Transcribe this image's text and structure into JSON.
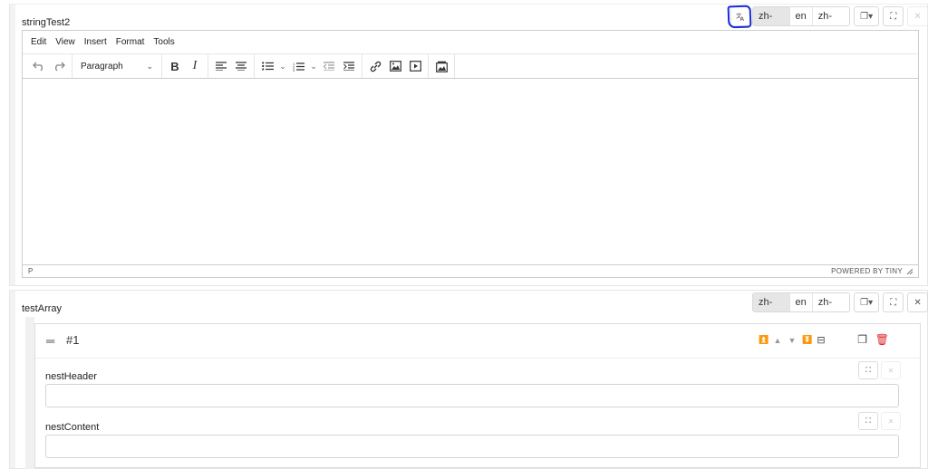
{
  "field1": {
    "label": "stringTest2",
    "translate_icon": "translate-icon",
    "languages": [
      "zh-HK",
      "en",
      "zh-CN"
    ],
    "active_language": "zh-HK",
    "copy_icon": "copy-dropdown-icon",
    "expand_icon": "expand-icon",
    "close_icon": "close-icon"
  },
  "editor": {
    "menus": [
      "Edit",
      "View",
      "Insert",
      "Format",
      "Tools"
    ],
    "block_format": "Paragraph",
    "status_path": "P",
    "powered_by": "POWERED BY TINY"
  },
  "field2": {
    "label": "testArray",
    "languages": [
      "zh-HK",
      "en",
      "zh-CN"
    ],
    "active_language": "zh-HK"
  },
  "array_item": {
    "title": "#1",
    "fields": [
      {
        "label": "nestHeader",
        "value": ""
      },
      {
        "label": "nestContent",
        "value": ""
      }
    ]
  }
}
